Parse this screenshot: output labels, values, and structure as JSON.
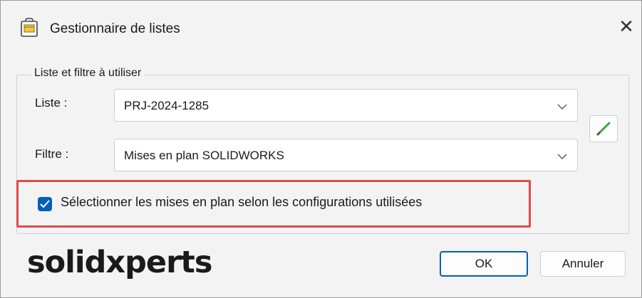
{
  "window": {
    "title": "Gestionnaire de listes",
    "title_icon": "list-manager-icon",
    "close_icon": "close-icon",
    "close_glyph": "✕"
  },
  "group": {
    "legend": "Liste et filtre à utiliser",
    "list_label": "Liste :",
    "list_value": "PRJ-2024-1285",
    "filter_label": "Filtre :",
    "filter_value": "Mises en plan SOLIDWORKS",
    "edit_icon": "pencil-icon"
  },
  "option": {
    "checked": true,
    "label": "Sélectionner les mises en plan selon les configurations utilisées"
  },
  "footer": {
    "logo": "solidxperts",
    "ok_label": "OK",
    "cancel_label": "Annuler"
  },
  "colors": {
    "accent": "#005fb8",
    "highlight": "#e04a4a",
    "pencil": "#3aa640"
  }
}
